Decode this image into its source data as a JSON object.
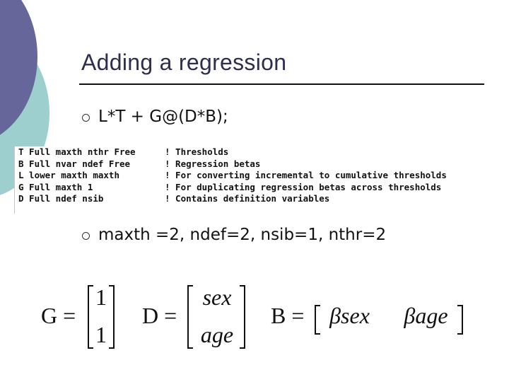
{
  "slide": {
    "title": "Adding a regression",
    "bullets": [
      "L*T + G@(D*B);",
      "maxth =2, ndef=2, nsib=1, nthr=2"
    ],
    "code": [
      {
        "decl": "T Full maxth nthr Free",
        "comment": "! Thresholds"
      },
      {
        "decl": "B Full nvar ndef Free",
        "comment": "! Regression betas"
      },
      {
        "decl": "L lower maxth maxth",
        "comment": "! For converting incremental to cumulative thresholds"
      },
      {
        "decl": "G Full maxth 1",
        "comment": "! For duplicating regression betas across thresholds"
      },
      {
        "decl": "D Full ndef nsib",
        "comment": "! Contains definition variables"
      }
    ],
    "equations": {
      "G": {
        "name": "G",
        "eq": "=",
        "cells": [
          "1",
          "1"
        ]
      },
      "D": {
        "name": "D",
        "eq": "=",
        "cells": [
          "sex",
          "age"
        ]
      },
      "B": {
        "name": "B",
        "eq": "=",
        "cells": [
          "βsex",
          "βage"
        ]
      }
    }
  },
  "colors": {
    "decor_purple": "#66669a",
    "decor_teal": "#9ccfce",
    "title": "#2e2e4e"
  }
}
